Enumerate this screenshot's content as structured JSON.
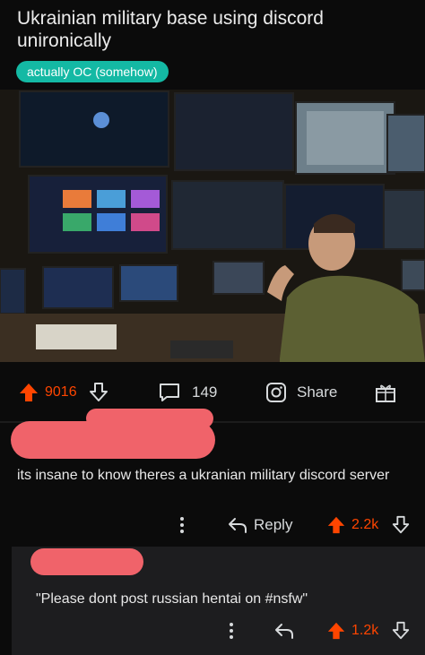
{
  "post": {
    "title": "Ukrainian military base using discord unironically",
    "flair": "actually OC (somehow)",
    "flair_color": "#14b9a4",
    "image_alt": "Photo of a military operations room with a wall of monitors, one showing a Discord video call"
  },
  "actions": {
    "upvotes": "9016",
    "comments": "149",
    "share": "Share",
    "upvote_color": "#ff4500"
  },
  "comments": [
    {
      "author": "redacted",
      "body": "its insane to know theres a ukranian military discord server",
      "reply_label": "Reply",
      "votes": "2.2k"
    },
    {
      "author": "redacted",
      "body": "\"Please dont post russian hentai on #nsfw\"",
      "votes": "1.2k"
    }
  ],
  "icons": [
    "upvote-arrow-icon",
    "downvote-arrow-icon",
    "comment-bubble-icon",
    "share-icon",
    "award-gift-icon",
    "more-dots-icon",
    "reply-arrow-icon"
  ]
}
